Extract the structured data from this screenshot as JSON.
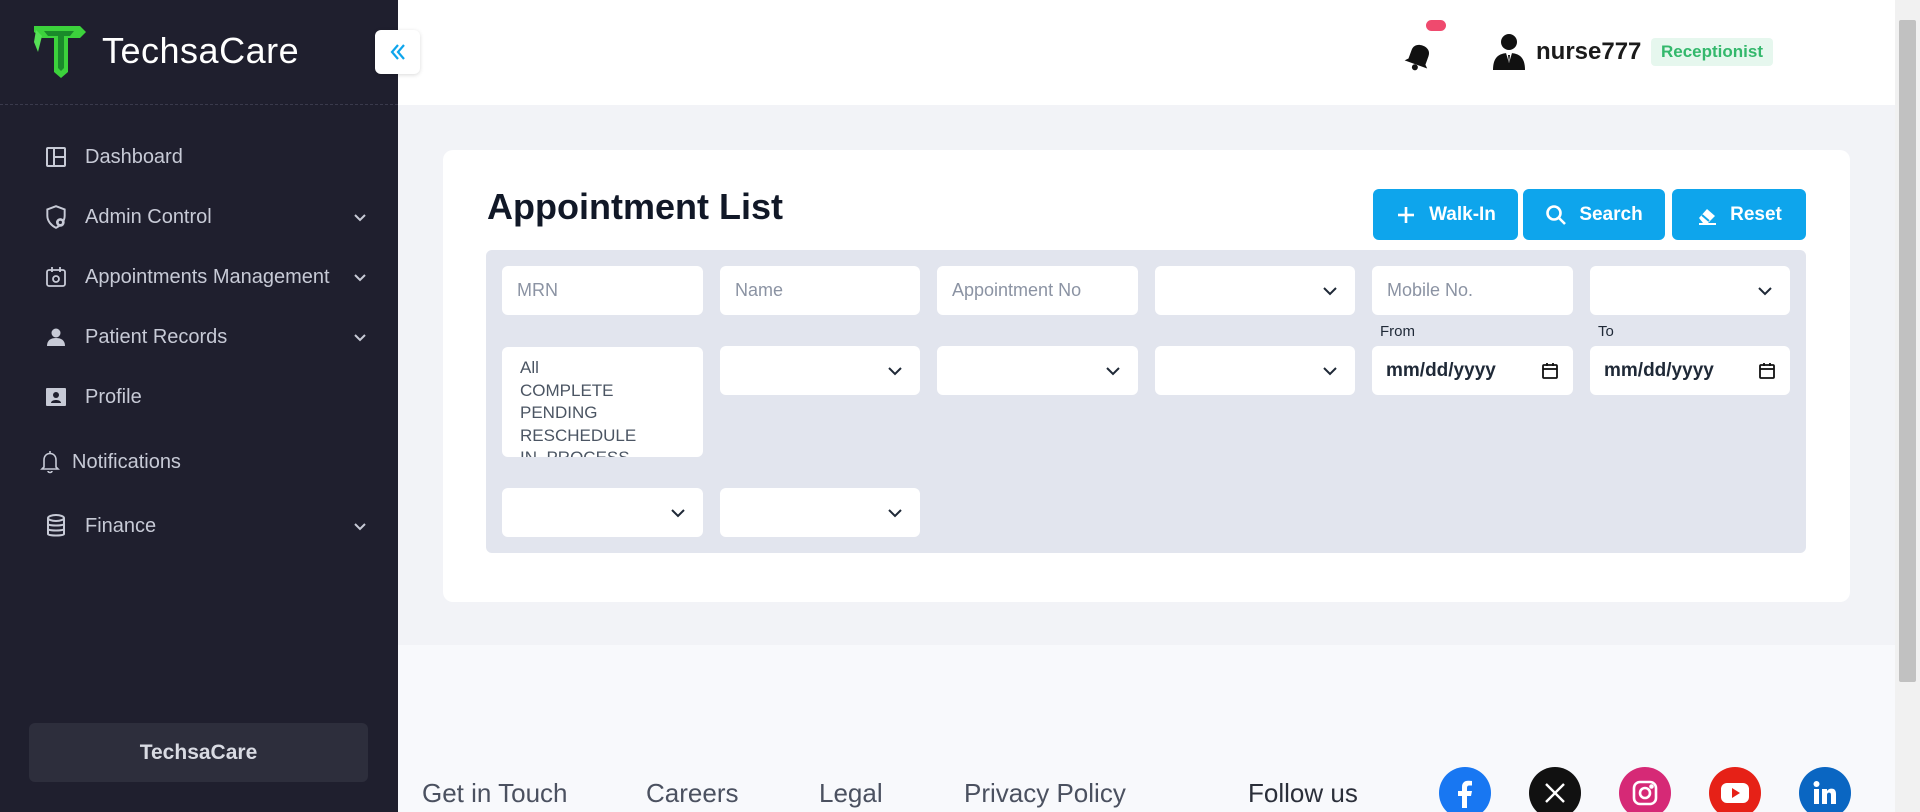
{
  "brand": {
    "name": "TechsaCare",
    "accent": "#3cd23c"
  },
  "sidebar": {
    "items": [
      {
        "label": "Dashboard",
        "icon": "dashboard-icon"
      },
      {
        "label": "Admin Control",
        "icon": "shield-gear-icon"
      },
      {
        "label": "Appointments Management",
        "icon": "calendar-gear-icon"
      },
      {
        "label": "Patient Records",
        "icon": "person-icon"
      },
      {
        "label": "Profile",
        "icon": "contact-card-icon"
      },
      {
        "label": "Notifications",
        "icon": "bell-outline-icon"
      },
      {
        "label": "Finance",
        "icon": "database-icon"
      }
    ],
    "footer_label": "TechsaCare"
  },
  "header": {
    "user_name": "nurse777",
    "role": "Receptionist"
  },
  "page": {
    "title": "Appointment List"
  },
  "buttons": {
    "walkin": "Walk-In",
    "search": "Search",
    "reset": "Reset"
  },
  "filters": {
    "mrn_placeholder": "MRN",
    "name_placeholder": "Name",
    "appointment_no_placeholder": "Appointment No",
    "mobile_placeholder": "Mobile No.",
    "from_label": "From",
    "to_label": "To",
    "from_value": "mm/dd/yyyy",
    "to_value": "mm/dd/yyyy",
    "status_options": [
      "All",
      "COMPLETE",
      "PENDING",
      "RESCHEDULE",
      "IN_PROCESS"
    ]
  },
  "footer": {
    "links": [
      "Get in Touch",
      "Careers",
      "Legal",
      "Privacy Policy"
    ],
    "follow_label": "Follow us",
    "social": [
      "facebook-icon",
      "x-icon",
      "instagram-icon",
      "youtube-icon",
      "linkedin-icon"
    ]
  },
  "colors": {
    "sidebar_bg": "#1f1f2e",
    "primary": "#0ea5ec",
    "badge": "#ef4a6e",
    "role_text": "#33b86c"
  }
}
